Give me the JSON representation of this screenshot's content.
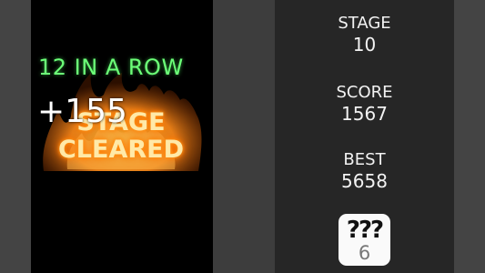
{
  "board": {
    "combo_text": "12 IN A ROW",
    "banner_line1": "STAGE",
    "banner_line2": "CLEARED",
    "points_text": "+155"
  },
  "panel": {
    "stage_label": "STAGE",
    "stage_value": "10",
    "score_label": "SCORE",
    "score_value": "1567",
    "best_label": "BEST",
    "best_value": "5658"
  },
  "hint_button": {
    "icon": "question-marks-icon",
    "symbol": "???",
    "count": "6"
  },
  "colors": {
    "combo": "#6cff78",
    "banner": "#ffe9a8",
    "flame": "#ff8c1a",
    "panel": "#262626"
  }
}
